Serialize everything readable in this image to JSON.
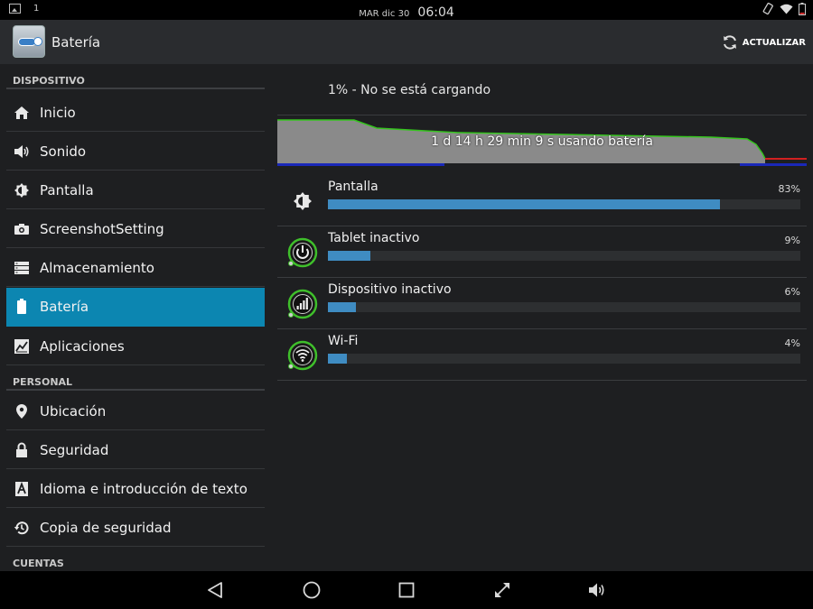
{
  "status_bar": {
    "notification_count": "1",
    "date": "MAR dic 30",
    "time": "06:04"
  },
  "app_bar": {
    "title": "Batería",
    "refresh_label": "ACTUALIZAR"
  },
  "sidebar": {
    "sections": {
      "device": "DISPOSITIVO",
      "personal": "PERSONAL",
      "accounts": "CUENTAS"
    },
    "items": [
      {
        "label": "Inicio",
        "icon": "home-icon"
      },
      {
        "label": "Sonido",
        "icon": "speaker-icon"
      },
      {
        "label": "Pantalla",
        "icon": "brightness-icon"
      },
      {
        "label": "ScreenshotSetting",
        "icon": "camera-icon"
      },
      {
        "label": "Almacenamiento",
        "icon": "storage-icon"
      },
      {
        "label": "Batería",
        "icon": "battery-icon",
        "active": true
      },
      {
        "label": "Aplicaciones",
        "icon": "apps-icon"
      },
      {
        "label": "Ubicación",
        "icon": "location-pin-icon"
      },
      {
        "label": "Seguridad",
        "icon": "lock-icon"
      },
      {
        "label": "Idioma e introducción de texto",
        "icon": "keyboard-a-icon"
      },
      {
        "label": "Copia de seguridad",
        "icon": "backup-clock-icon"
      }
    ]
  },
  "battery": {
    "status": "1% - No se está cargando",
    "graph_label": "1 d 14 h 29 min 9 s usando batería",
    "usage": [
      {
        "name": "Pantalla",
        "percent": "83%",
        "value": 83,
        "icon": "brightness-icon"
      },
      {
        "name": "Tablet inactivo",
        "percent": "9%",
        "value": 9,
        "icon": "power-icon"
      },
      {
        "name": "Dispositivo inactivo",
        "percent": "6%",
        "value": 6,
        "icon": "signal-bars-icon"
      },
      {
        "name": "Wi-Fi",
        "percent": "4%",
        "value": 4,
        "icon": "wifi-icon"
      }
    ]
  },
  "colors": {
    "accent": "#0c86b1",
    "bar_fill": "#3f8cc2",
    "graph_line": "#35c41e",
    "graph_fill": "#8a8a8a",
    "graph_low": "#d22020"
  }
}
